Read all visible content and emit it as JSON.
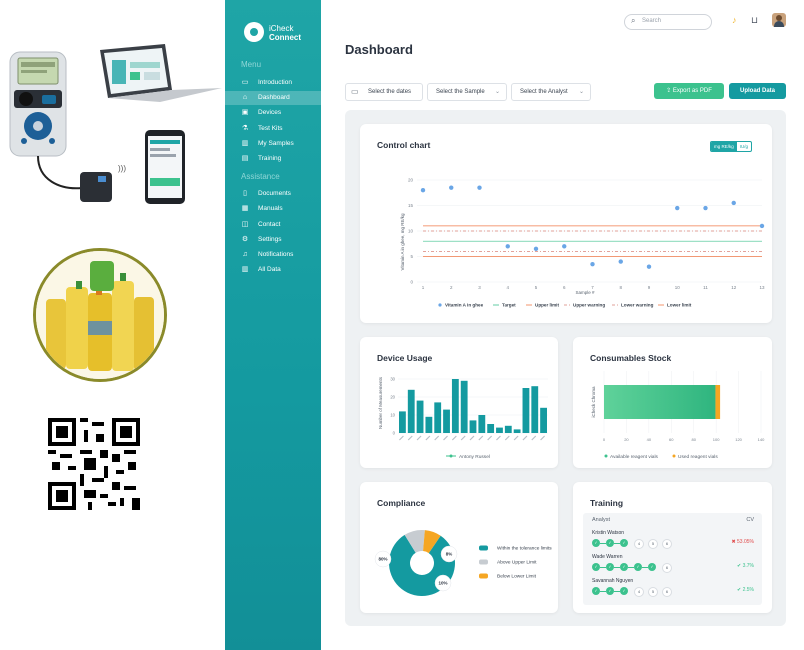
{
  "app": {
    "name_line1": "iCheck",
    "name_line2": "Connect"
  },
  "sidebar": {
    "menu_label": "Menu",
    "assistance_label": "Assistance",
    "menu_items": [
      {
        "label": "Introduction",
        "icon": "monitor-icon"
      },
      {
        "label": "Dashboard",
        "icon": "home-icon"
      },
      {
        "label": "Devices",
        "icon": "devices-icon"
      },
      {
        "label": "Test Kits",
        "icon": "flask-icon"
      },
      {
        "label": "My Samples",
        "icon": "bar-chart-icon"
      },
      {
        "label": "Training",
        "icon": "training-icon"
      }
    ],
    "assistance_items": [
      {
        "label": "Documents",
        "icon": "document-icon"
      },
      {
        "label": "Manuals",
        "icon": "manual-icon"
      },
      {
        "label": "Contact",
        "icon": "contact-icon"
      },
      {
        "label": "Settings",
        "icon": "gear-icon"
      },
      {
        "label": "Notifications",
        "icon": "bell-icon"
      },
      {
        "label": "All Data",
        "icon": "data-icon"
      }
    ]
  },
  "header": {
    "search_placeholder": "Search"
  },
  "page": {
    "title": "Dashboard"
  },
  "filters": {
    "dates": "Select the dates",
    "sample": "Select the Sample",
    "analyst": "Select the Analyst"
  },
  "actions": {
    "export": "Export as PDF",
    "upload": "Upload Data"
  },
  "colors": {
    "teal": "#1fa5a6",
    "green": "#3cc28e",
    "orange": "#f5a623",
    "blue_dot": "#6aa6e6"
  },
  "control_chart": {
    "title": "Control chart",
    "unit_toggle": [
      "mg RE/kg",
      "IU/g"
    ],
    "ylabel": "Vitamin A in ghee, mg RE/kg",
    "xlabel": "Sample #",
    "legend": [
      "Vitamin A in ghee",
      "Target",
      "Upper limit",
      "Upper warning",
      "Lower warning",
      "Lower limit"
    ]
  },
  "device_usage": {
    "title": "Device Usage",
    "ylabel": "Number of Measurements",
    "legend": "Antony Russel"
  },
  "consumables": {
    "title": "Consumables Stock",
    "ylabel": "iCheck Chroma",
    "legend_available": "Available reagent vials",
    "legend_used": "Used reagent vials"
  },
  "compliance": {
    "title": "Compliance",
    "legend": [
      "Within the tolerance limits",
      "Above Upper Limit",
      "Below Lower Limit"
    ],
    "labels": [
      "80%",
      "10%",
      "8%"
    ]
  },
  "training": {
    "title": "Training",
    "col_analyst": "Analyst",
    "col_cv": "CV",
    "rows": [
      {
        "name": "Kristin Watson",
        "done": 3,
        "cv": "53.05%",
        "status": "fail"
      },
      {
        "name": "Wade Warren",
        "done": 5,
        "cv": "3.7%",
        "status": "pass"
      },
      {
        "name": "Savannah Nguyen",
        "done": 3,
        "cv": "2.5%",
        "status": "pass"
      }
    ]
  },
  "chart_data": [
    {
      "type": "scatter",
      "title": "Control chart",
      "xlabel": "Sample #",
      "ylabel": "Vitamin A in ghee, mg RE/kg",
      "x": [
        1,
        2,
        3,
        4,
        5,
        6,
        7,
        8,
        9,
        10,
        11,
        12,
        13
      ],
      "series": [
        {
          "name": "Vitamin A in ghee",
          "values": [
            18.0,
            18.5,
            18.5,
            7.0,
            6.5,
            7.0,
            3.5,
            4.0,
            3.0,
            14.5,
            14.5,
            15.5,
            11.0
          ]
        }
      ],
      "lines": [
        {
          "name": "Target",
          "value": 8.0
        },
        {
          "name": "Upper limit",
          "value": 11.0
        },
        {
          "name": "Upper warning",
          "value": 10.0
        },
        {
          "name": "Lower warning",
          "value": 6.0
        },
        {
          "name": "Lower limit",
          "value": 5.0
        }
      ],
      "ylim": [
        0,
        20
      ],
      "yticks": [
        0,
        5,
        10,
        15,
        20
      ],
      "xlim": [
        1,
        13
      ],
      "grid": true,
      "legend": "bottom"
    },
    {
      "type": "bar",
      "title": "Device Usage",
      "ylabel": "Number of Measurements",
      "categories": [
        "c1",
        "c2",
        "c3",
        "c4",
        "c5",
        "c6",
        "c7",
        "c8",
        "c9",
        "c10",
        "c11",
        "c12",
        "c13",
        "c14",
        "c15",
        "c16",
        "c17",
        "c18",
        "c19"
      ],
      "series": [
        {
          "name": "Antony Russel",
          "values": [
            12,
            24,
            18,
            9,
            17,
            13,
            30,
            29,
            7,
            10,
            5,
            3,
            4,
            2,
            25,
            26,
            14,
            0,
            0
          ]
        }
      ],
      "ylim": [
        0,
        35
      ],
      "yticks": [
        0,
        10,
        20,
        30
      ],
      "legend": "bottom"
    },
    {
      "type": "bar",
      "title": "Consumables Stock",
      "orientation": "horizontal",
      "categories": [
        "iCheck Chroma"
      ],
      "series": [
        {
          "name": "Available reagent vials",
          "values": [
            96
          ]
        },
        {
          "name": "Used reagent vials",
          "values": [
            4
          ]
        }
      ],
      "xlim": [
        0,
        100
      ],
      "legend": "bottom"
    },
    {
      "type": "pie",
      "title": "Compliance",
      "labels": [
        "Within the tolerance limits",
        "Above Upper Limit",
        "Below Lower Limit"
      ],
      "values": [
        80,
        10,
        8
      ],
      "donut": true
    }
  ]
}
